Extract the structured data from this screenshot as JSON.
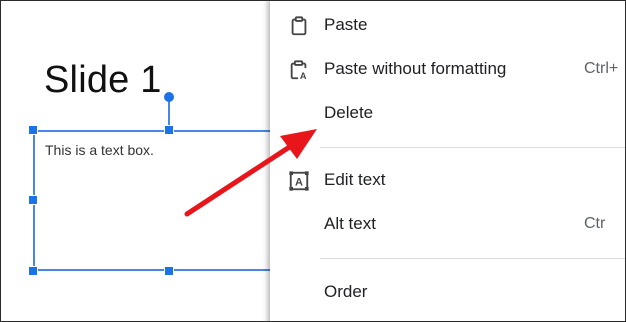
{
  "slide": {
    "title": "Slide 1",
    "textbox_text": "This is a text box."
  },
  "context_menu": {
    "items": [
      {
        "label": "Paste",
        "icon": "paste-icon",
        "shortcut": ""
      },
      {
        "label": "Paste without formatting",
        "icon": "paste-without-formatting-icon",
        "shortcut": "Ctrl+"
      },
      {
        "label": "Delete",
        "icon": "",
        "shortcut": ""
      },
      {
        "label": "Edit text",
        "icon": "edit-text-icon",
        "shortcut": ""
      },
      {
        "label": "Alt text",
        "icon": "",
        "shortcut": "Ctr"
      },
      {
        "label": "Order",
        "icon": "",
        "shortcut": ""
      }
    ]
  },
  "colors": {
    "selection": "#4a86e8",
    "handle": "#1a73e8",
    "annotation_arrow": "#e8161b",
    "menu_text": "#202124",
    "shortcut_text": "#5f6368"
  }
}
